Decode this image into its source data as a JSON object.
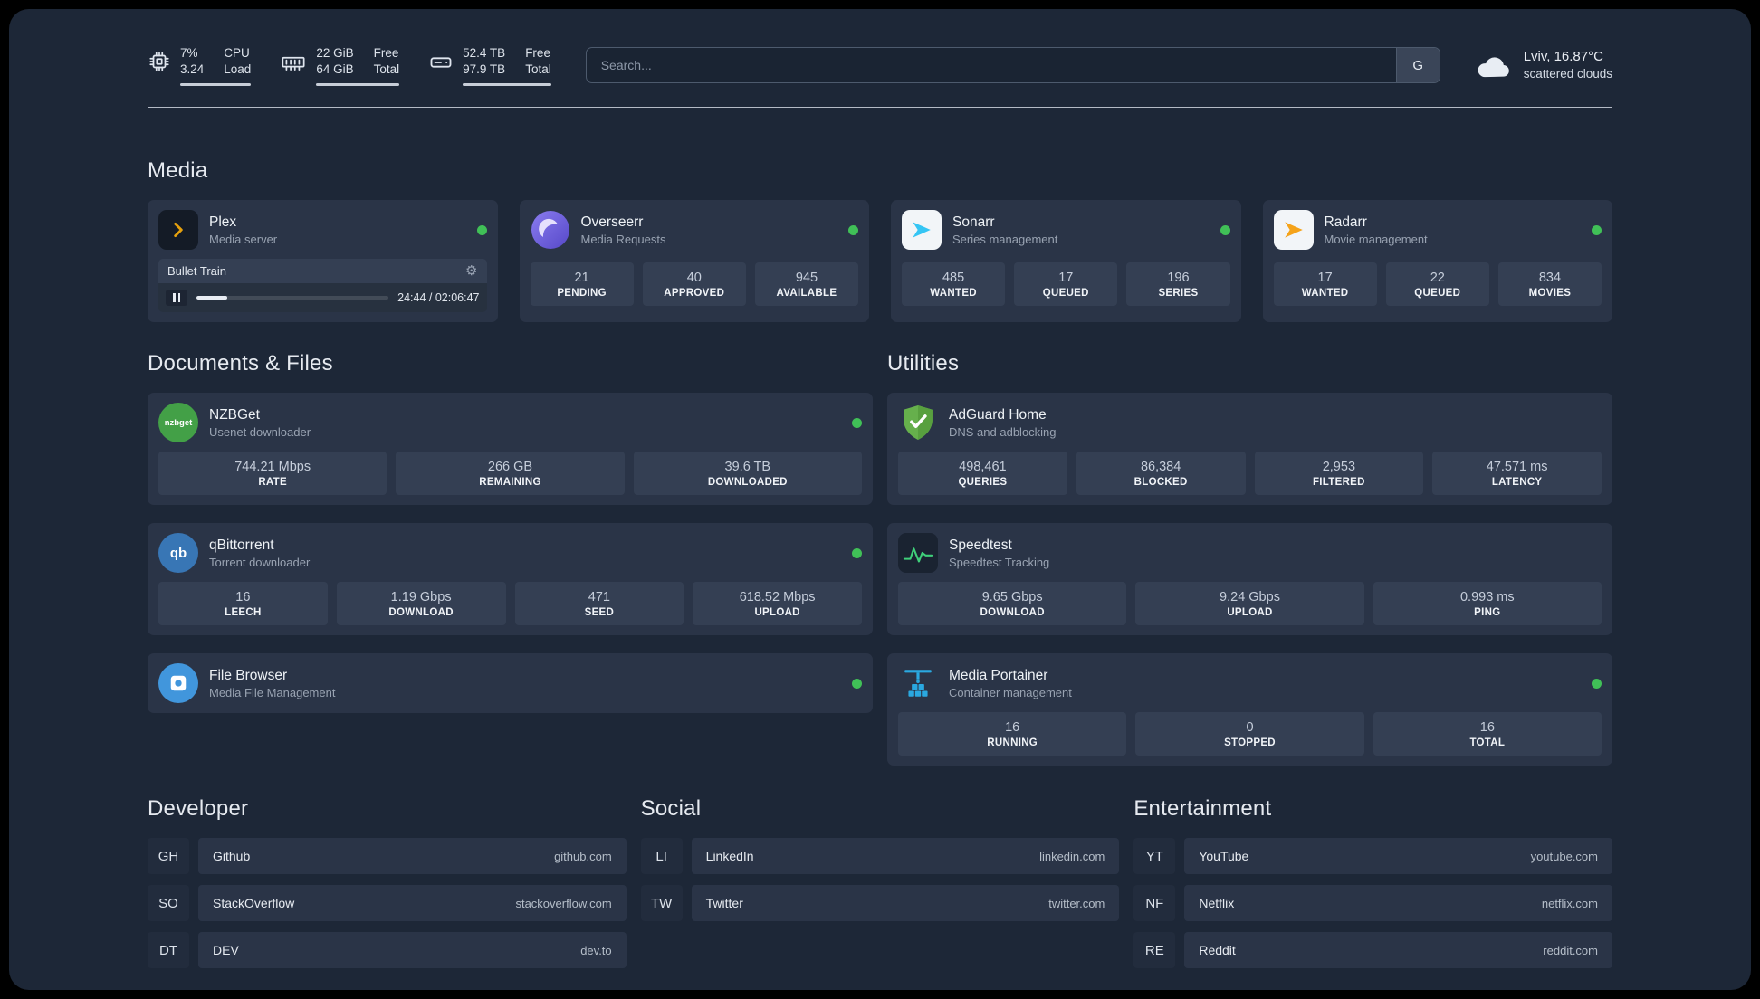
{
  "topbar": {
    "cpu": {
      "value": "7%",
      "sub": "3.24",
      "label1": "CPU",
      "label2": "Load"
    },
    "ram": {
      "value": "22 GiB",
      "sub": "64 GiB",
      "label1": "Free",
      "label2": "Total"
    },
    "disk": {
      "value": "52.4 TB",
      "sub": "97.9 TB",
      "label1": "Free",
      "label2": "Total"
    },
    "search": {
      "placeholder": "Search...",
      "engine": "G"
    },
    "weather": {
      "title": "Lviv, 16.87°C",
      "subtitle": "scattered clouds"
    }
  },
  "icons": {
    "gear": "⚙"
  },
  "media": {
    "heading": "Media",
    "plex": {
      "name": "Plex",
      "subtitle": "Media server",
      "now_playing": "Bullet Train",
      "time": "24:44 / 02:06:47"
    },
    "overseerr": {
      "name": "Overseerr",
      "subtitle": "Media Requests",
      "stats": [
        {
          "value": "21",
          "label": "PENDING"
        },
        {
          "value": "40",
          "label": "APPROVED"
        },
        {
          "value": "945",
          "label": "AVAILABLE"
        }
      ]
    },
    "sonarr": {
      "name": "Sonarr",
      "subtitle": "Series management",
      "stats": [
        {
          "value": "485",
          "label": "WANTED"
        },
        {
          "value": "17",
          "label": "QUEUED"
        },
        {
          "value": "196",
          "label": "SERIES"
        }
      ]
    },
    "radarr": {
      "name": "Radarr",
      "subtitle": "Movie management",
      "stats": [
        {
          "value": "17",
          "label": "WANTED"
        },
        {
          "value": "22",
          "label": "QUEUED"
        },
        {
          "value": "834",
          "label": "MOVIES"
        }
      ]
    }
  },
  "documents": {
    "heading": "Documents & Files",
    "nzbget": {
      "name": "NZBGet",
      "subtitle": "Usenet downloader",
      "icon_text": "nzbget",
      "stats": [
        {
          "value": "744.21 Mbps",
          "label": "RATE"
        },
        {
          "value": "266 GB",
          "label": "REMAINING"
        },
        {
          "value": "39.6 TB",
          "label": "DOWNLOADED"
        }
      ]
    },
    "qbittorrent": {
      "name": "qBittorrent",
      "subtitle": "Torrent downloader",
      "icon_text": "qb",
      "stats": [
        {
          "value": "16",
          "label": "LEECH"
        },
        {
          "value": "1.19 Gbps",
          "label": "DOWNLOAD"
        },
        {
          "value": "471",
          "label": "SEED"
        },
        {
          "value": "618.52 Mbps",
          "label": "UPLOAD"
        }
      ]
    },
    "filebrowser": {
      "name": "File Browser",
      "subtitle": "Media File Management"
    }
  },
  "utilities": {
    "heading": "Utilities",
    "adguard": {
      "name": "AdGuard Home",
      "subtitle": "DNS and adblocking",
      "stats": [
        {
          "value": "498,461",
          "label": "QUERIES"
        },
        {
          "value": "86,384",
          "label": "BLOCKED"
        },
        {
          "value": "2,953",
          "label": "FILTERED"
        },
        {
          "value": "47.571 ms",
          "label": "LATENCY"
        }
      ]
    },
    "speedtest": {
      "name": "Speedtest",
      "subtitle": "Speedtest Tracking",
      "stats": [
        {
          "value": "9.65 Gbps",
          "label": "DOWNLOAD"
        },
        {
          "value": "9.24 Gbps",
          "label": "UPLOAD"
        },
        {
          "value": "0.993 ms",
          "label": "PING"
        }
      ]
    },
    "portainer": {
      "name": "Media Portainer",
      "subtitle": "Container management",
      "stats": [
        {
          "value": "16",
          "label": "RUNNING"
        },
        {
          "value": "0",
          "label": "STOPPED"
        },
        {
          "value": "16",
          "label": "TOTAL"
        }
      ]
    }
  },
  "bookmarks": {
    "developer": {
      "heading": "Developer",
      "items": [
        {
          "abbr": "GH",
          "name": "Github",
          "url": "github.com"
        },
        {
          "abbr": "SO",
          "name": "StackOverflow",
          "url": "stackoverflow.com"
        },
        {
          "abbr": "DT",
          "name": "DEV",
          "url": "dev.to"
        }
      ]
    },
    "social": {
      "heading": "Social",
      "items": [
        {
          "abbr": "LI",
          "name": "LinkedIn",
          "url": "linkedin.com"
        },
        {
          "abbr": "TW",
          "name": "Twitter",
          "url": "twitter.com"
        }
      ]
    },
    "entertainment": {
      "heading": "Entertainment",
      "items": [
        {
          "abbr": "YT",
          "name": "YouTube",
          "url": "youtube.com"
        },
        {
          "abbr": "NF",
          "name": "Netflix",
          "url": "netflix.com"
        },
        {
          "abbr": "RE",
          "name": "Reddit",
          "url": "reddit.com"
        }
      ]
    }
  },
  "colors": {
    "status_online": "#40c057",
    "accent_plex": "#e5a00d",
    "accent_sonarr": "#35c5f4",
    "accent_radarr": "#f5a31a"
  }
}
